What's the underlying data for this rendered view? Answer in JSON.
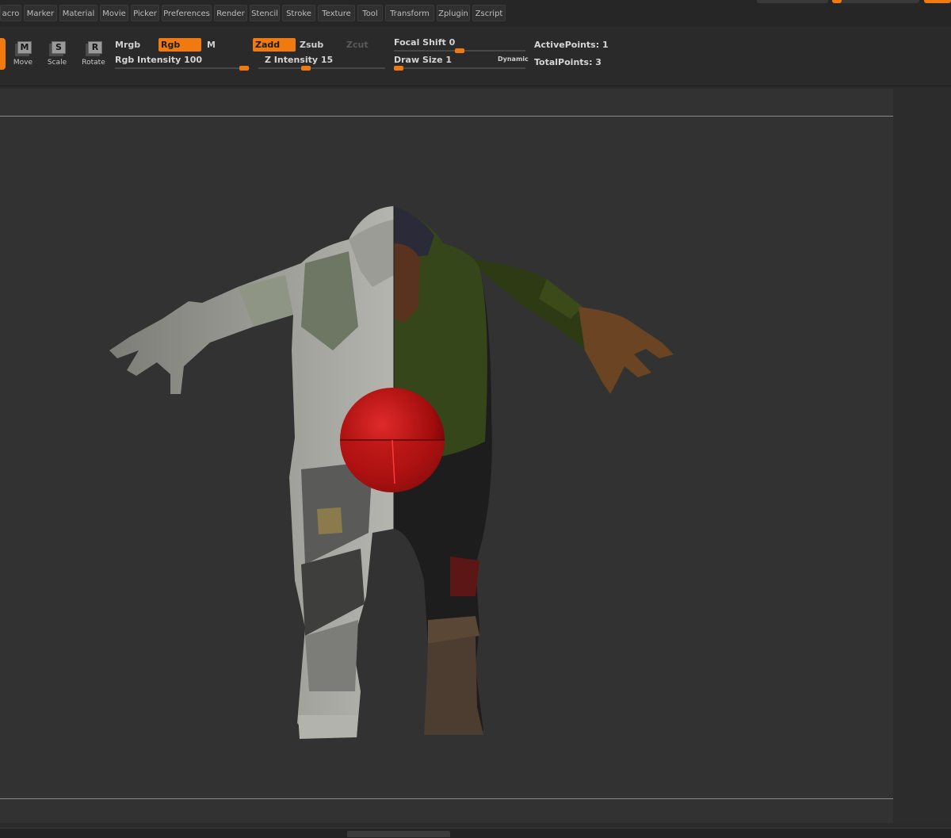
{
  "menu": {
    "items": [
      "acro",
      "Marker",
      "Material",
      "Movie",
      "Picker",
      "Preferences",
      "Render",
      "Stencil",
      "Stroke",
      "Texture",
      "Tool",
      "Transform",
      "Zplugin",
      "Zscript"
    ]
  },
  "toolbar": {
    "move": {
      "letter": "M",
      "label": "Move"
    },
    "scale": {
      "letter": "S",
      "label": "Scale"
    },
    "rotate": {
      "letter": "R",
      "label": "Rotate"
    },
    "mrgb": "Mrgb",
    "rgb": "Rgb",
    "m": "M",
    "zadd": "Zadd",
    "zsub": "Zsub",
    "zcut": "Zcut",
    "rgb_intensity_label": "Rgb  Intensity 100",
    "rgb_intensity_value": 100,
    "z_intensity_label": "Z  Intensity 15",
    "z_intensity_value": 15,
    "focal_shift_label": "Focal  Shift 0",
    "focal_shift_value": 0,
    "draw_size_label": "Draw  Size 1",
    "draw_size_value": 1,
    "dynamic_label": "Dynamic",
    "active_points": "ActivePoints: 1",
    "total_points": "TotalPoints: 3"
  },
  "colors": {
    "accent": "#f07a10",
    "panel": "#2a2a2a",
    "canvas": "#323232",
    "sphere": "#c01010"
  },
  "icons": {
    "move": "move-gizmo-icon",
    "scale": "scale-gizmo-icon",
    "rotate": "rotate-gizmo-icon"
  }
}
